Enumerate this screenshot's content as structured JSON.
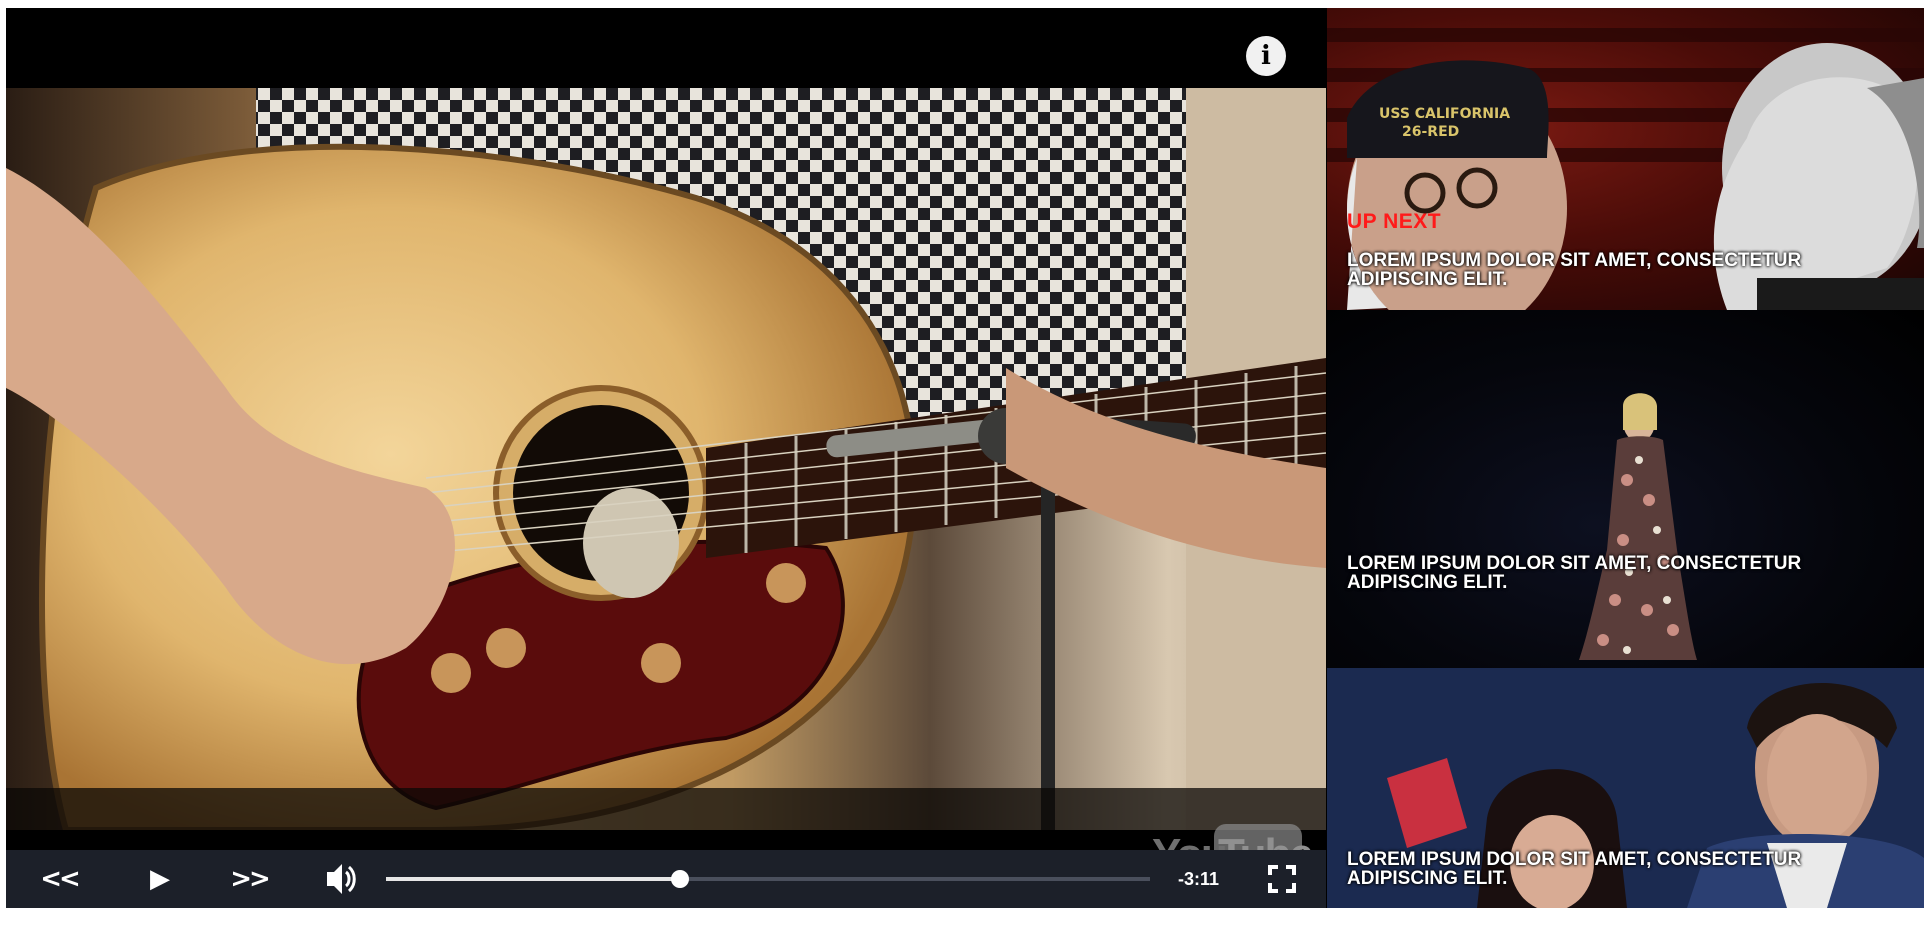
{
  "player": {
    "info_label": "i",
    "controls": {
      "prev_label": "<<",
      "play_label": "▶",
      "next_label": ">>",
      "volume_label": "🔊",
      "time_remaining": "-3:11",
      "progress_fraction": 0.385,
      "fullscreen_icon": "fullscreen-icon"
    },
    "watermark": {
      "you": "You",
      "tube": "Tube"
    }
  },
  "playlist": {
    "up_next_label": "UP NEXT",
    "items": [
      {
        "title": "LOREM IPSUM DOLOR SIT AMET, CONSECTETUR ADIPISCING ELIT."
      },
      {
        "title": "LOREM IPSUM DOLOR SIT AMET, CONSECTETUR ADIPISCING ELIT."
      },
      {
        "title": "LOREM IPSUM DOLOR SIT AMET, CONSECTETUR ADIPISCING ELIT."
      }
    ]
  },
  "colors": {
    "control_bar": "#1c2029",
    "up_next": "#ff1a1a",
    "background": "#000000"
  }
}
